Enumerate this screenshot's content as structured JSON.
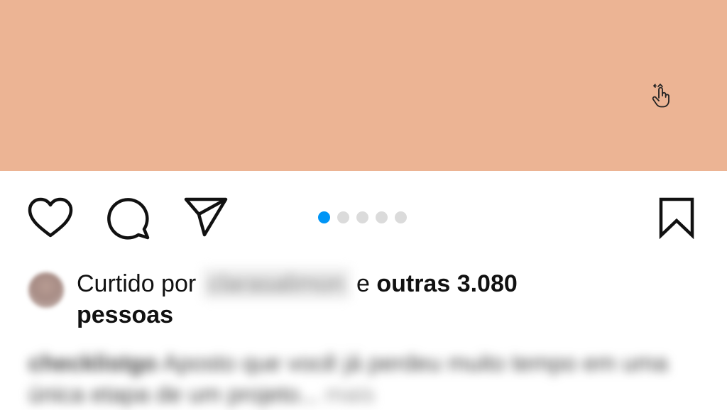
{
  "media": {
    "background_color": "#ecb494",
    "swipe_hint_icon": "swipe-hand-icon"
  },
  "actions": {
    "like_icon": "heart-icon",
    "comment_icon": "comment-bubble-icon",
    "share_icon": "paper-plane-icon",
    "save_icon": "bookmark-icon"
  },
  "carousel": {
    "total": 5,
    "active_index": 0,
    "active_color": "#0095f6",
    "inactive_color": "#dbdbdb"
  },
  "likes": {
    "prefix": "Curtido por",
    "liker": "clarasalimon",
    "connector": "e",
    "others": "outras 3.080",
    "suffix": "pessoas"
  },
  "caption": {
    "username": "checklistgo",
    "text": "Aposto que você já perdeu muito tempo em uma única etapa de um projeto...",
    "more": "mais"
  }
}
